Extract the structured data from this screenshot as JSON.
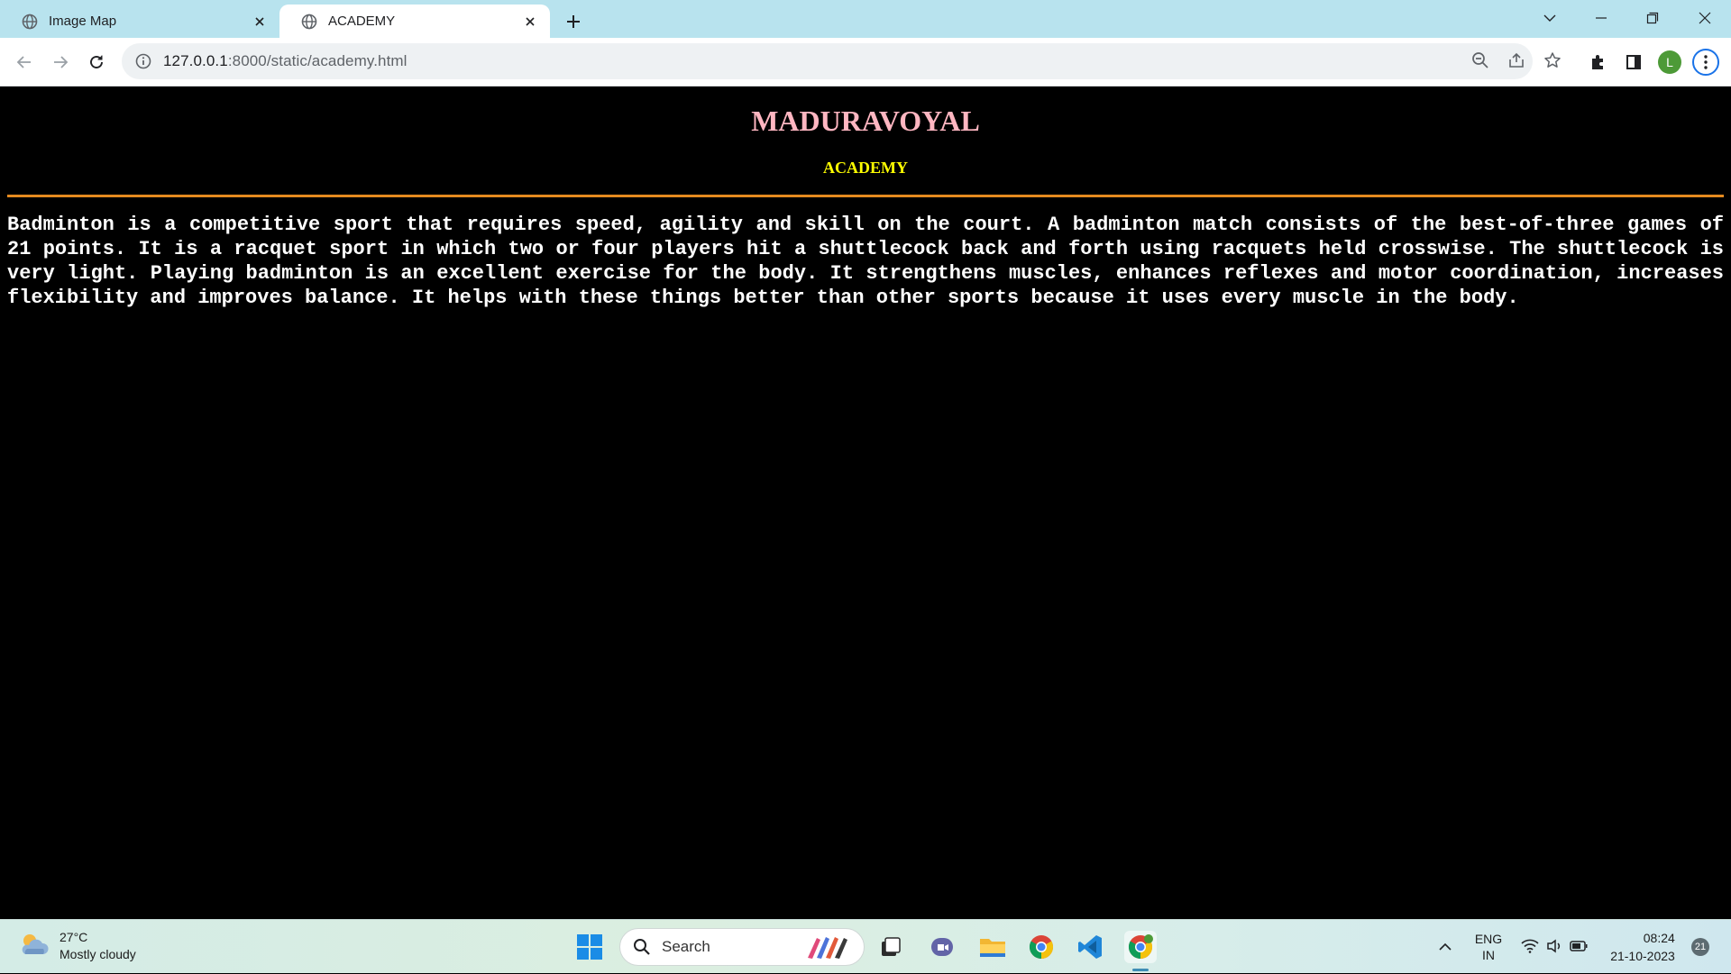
{
  "browser": {
    "tabs": [
      {
        "title": "Image Map",
        "active": false
      },
      {
        "title": "ACADEMY",
        "active": true
      }
    ],
    "url": {
      "host": "127.0.0.1",
      "path": ":8000/static/academy.html"
    },
    "profile_initial": "L"
  },
  "page": {
    "heading": "MADURAVOYAL",
    "subheading": "ACADEMY",
    "paragraph": "Badminton is a competitive sport that requires speed, agility and skill on the court. A badminton match consists of the best-of-three games of 21 points. It is a racquet sport in which two or four players hit a shuttlecock back and forth using racquets held crosswise. The shuttlecock is very light. Playing badminton is an excellent exercise for the body. It strengthens muscles, enhances reflexes and motor coordination, increases flexibility and improves balance. It helps with these things better than other sports because it uses every muscle in the body.",
    "colors": {
      "heading": "#ffb6c1",
      "subheading": "#ffff00",
      "rule": "#e58a1f",
      "text": "#ffffff",
      "background": "#000000"
    }
  },
  "taskbar": {
    "weather": {
      "temp": "27°C",
      "condition": "Mostly cloudy"
    },
    "search_placeholder": "Search",
    "language": {
      "line1": "ENG",
      "line2": "IN"
    },
    "clock": {
      "time": "08:24",
      "date": "21-10-2023"
    },
    "notifications": "21"
  }
}
